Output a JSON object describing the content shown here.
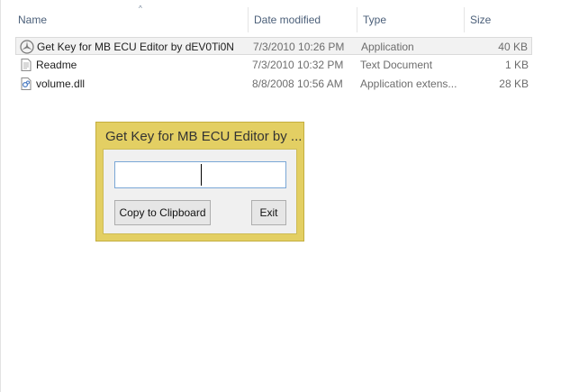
{
  "columns": [
    {
      "key": "name",
      "label": "Name"
    },
    {
      "key": "date",
      "label": "Date modified"
    },
    {
      "key": "type",
      "label": "Type"
    },
    {
      "key": "size",
      "label": "Size"
    }
  ],
  "sort_indicator": "^",
  "files": [
    {
      "name": "Get Key for MB ECU Editor by dEV0Ti0N",
      "date": "7/3/2010 10:26 PM",
      "type": "Application",
      "size": "40 KB",
      "icon": "mercedes-star-icon",
      "selected": true
    },
    {
      "name": "Readme",
      "date": "7/3/2010 10:32 PM",
      "type": "Text Document",
      "size": "1 KB",
      "icon": "text-document-icon",
      "selected": false
    },
    {
      "name": "volume.dll",
      "date": "8/8/2008 10:56 AM",
      "type": "Application extens...",
      "size": "28 KB",
      "icon": "dll-file-icon",
      "selected": false
    }
  ],
  "dialog": {
    "title": "Get Key for MB ECU Editor by ...",
    "input_value": "",
    "copy_label": "Copy to Clipboard",
    "exit_label": "Exit"
  },
  "colors": {
    "dialog_frame": "#e3cf63",
    "input_border": "#7aa7d6",
    "header_text": "#4c607a"
  }
}
